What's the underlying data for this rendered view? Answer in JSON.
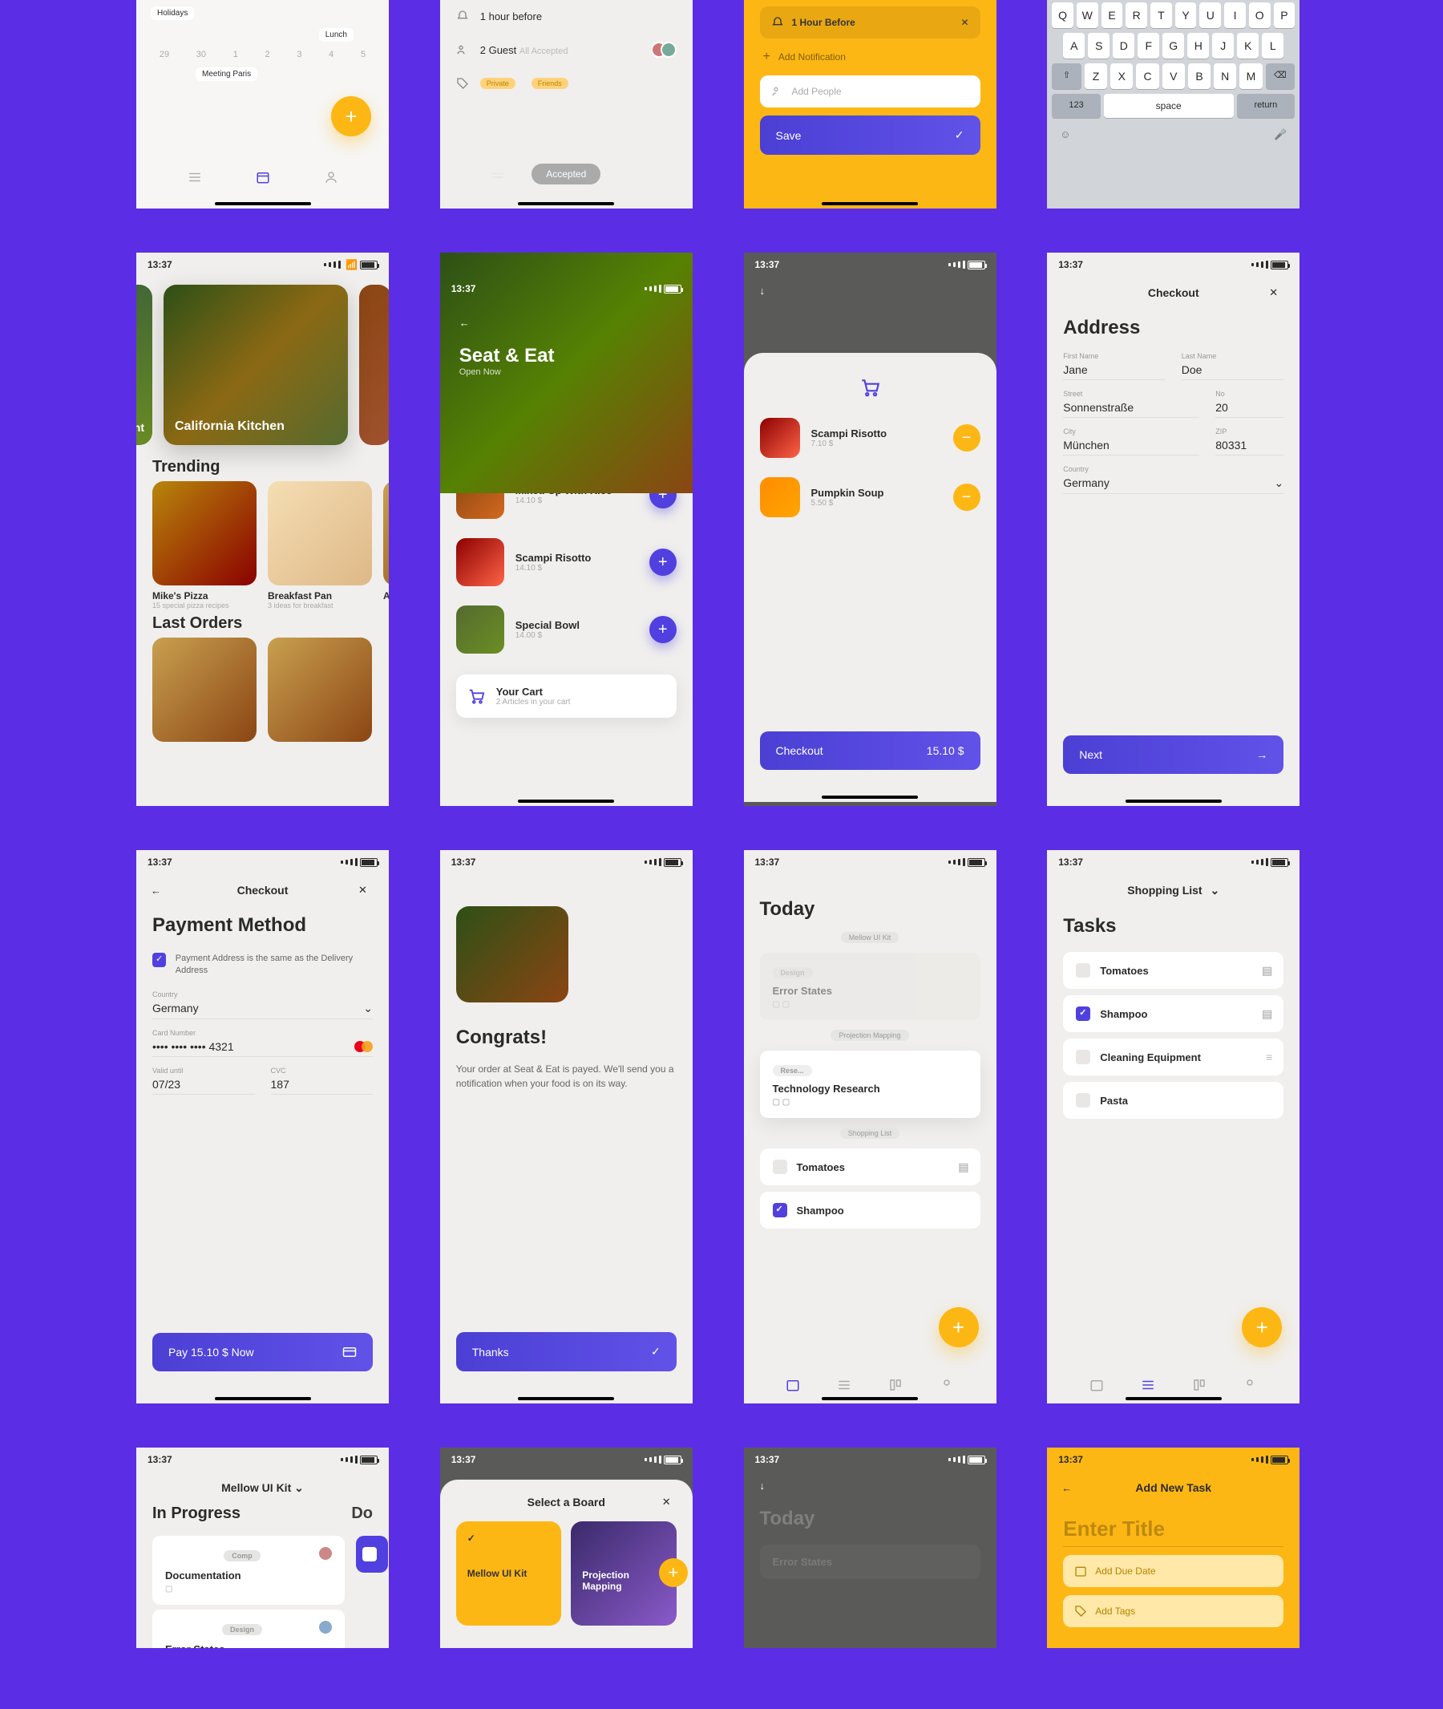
{
  "status_time": "13:37",
  "r1a": {
    "holidays": "Holidays",
    "lunch": "Lunch",
    "meeting": "Meeting Paris",
    "days": [
      "29",
      "30",
      "1",
      "2",
      "3",
      "4",
      "5"
    ]
  },
  "r1b": {
    "hour": "1 hour before",
    "guest": "2 Guest",
    "guest_s": "All Accepted",
    "p1": "Private",
    "p2": "Friends",
    "accepted": "Accepted"
  },
  "r1c": {
    "hour": "1 Hour Before",
    "add": "Add Notification",
    "people": "Add People",
    "save": "Save"
  },
  "kbd": {
    "r1": [
      "Q",
      "W",
      "E",
      "R",
      "T",
      "Y",
      "U",
      "I",
      "O",
      "P"
    ],
    "r2": [
      "A",
      "S",
      "D",
      "F",
      "G",
      "H",
      "J",
      "K",
      "L"
    ],
    "r3": [
      "Z",
      "X",
      "C",
      "V",
      "B",
      "N",
      "M"
    ],
    "num": "123",
    "space": "space",
    "ret": "return"
  },
  "r2a": {
    "hero": "California Kitchen",
    "trending": "Trending",
    "last": "Last Orders",
    "items": [
      {
        "n": "Mike's Pizza",
        "s": "15 special pizza recipes"
      },
      {
        "n": "Breakfast Pan",
        "s": "3 ideas for breakfast"
      },
      {
        "n": "As"
      }
    ]
  },
  "r2b": {
    "title": "Seat & Eat",
    "sub": "Open Now",
    "items": [
      {
        "n": "Mixed Up With Rice",
        "p": "14.10 $"
      },
      {
        "n": "Scampi Risotto",
        "p": "14.10 $"
      },
      {
        "n": "Special Bowl",
        "p": "14.00 $"
      }
    ],
    "cart": "Your Cart",
    "cartsub": "2 Articles in your cart"
  },
  "r2c": {
    "items": [
      {
        "n": "Scampi Risotto",
        "p": "7.10 $"
      },
      {
        "n": "Pumpkin Soup",
        "p": "5.50 $"
      }
    ],
    "checkout": "Checkout",
    "total": "15.10 $"
  },
  "r2d": {
    "title": "Checkout",
    "addr": "Address",
    "fn": "First Name",
    "fnv": "Jane",
    "ln": "Last Name",
    "lnv": "Doe",
    "st": "Street",
    "stv": "Sonnenstraße",
    "no": "No",
    "nov": "20",
    "ci": "City",
    "civ": "München",
    "zi": "ZIP",
    "ziv": "80331",
    "co": "Country",
    "cov": "Germany",
    "next": "Next"
  },
  "r3a": {
    "title": "Checkout",
    "h": "Payment Method",
    "chk": "Payment Address is the same as the Delivery Address",
    "co": "Country",
    "cov": "Germany",
    "cn": "Card Number",
    "cnv": "•••• •••• •••• 4321",
    "vu": "Valid until",
    "vuv": "07/23",
    "cvc": "CVC",
    "cvcv": "187",
    "pay": "Pay 15.10 $ Now"
  },
  "r3b": {
    "h": "Congrats!",
    "p": "Your order at Seat & Eat is payed. We'll send you a notification when your food is on its way.",
    "thanks": "Thanks"
  },
  "r3c": {
    "today": "Today",
    "t1": "Mellow UI Kit",
    "t1c": "Design",
    "t1n": "Error States",
    "t2": "Projection Mapping",
    "t2c": "Rese...",
    "t2n": "Technology Research",
    "t3": "Shopping List",
    "i1": "Tomatoes",
    "i2": "Shampoo"
  },
  "r3d": {
    "title": "Shopping List",
    "h": "Tasks",
    "items": [
      "Tomatoes",
      "Shampoo",
      "Cleaning Equipment",
      "Pasta"
    ]
  },
  "r4a": {
    "title": "Mellow UI Kit",
    "h": "In Progress",
    "h2": "Do",
    "t1": "Comp",
    "n1": "Documentation",
    "t2": "Design",
    "n2": "Error States"
  },
  "r4b": {
    "title": "Select a Board",
    "b1": "Mellow UI Kit",
    "b2": "Projection Mapping"
  },
  "r4c": {
    "today": "Today",
    "n": "Error States"
  },
  "r4d": {
    "title": "Add New Task",
    "h": "Enter Title",
    "d": "Add Due Date",
    "t": "Add Tags"
  }
}
